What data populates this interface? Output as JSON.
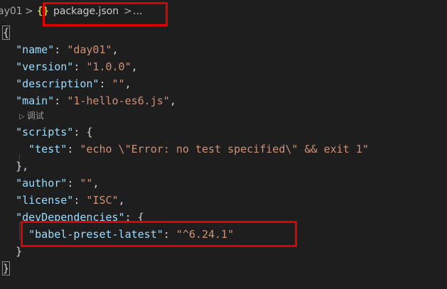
{
  "breadcrumb": {
    "folder": "ay01",
    "separator": ">",
    "json_icon": "{}",
    "file": "package.json",
    "more": "..."
  },
  "codelens": {
    "icon": "▷",
    "label": "调试"
  },
  "code": {
    "open": "{",
    "name_key": "\"name\"",
    "name_val": "\"day01\"",
    "version_key": "\"version\"",
    "version_val": "\"1.0.0\"",
    "description_key": "\"description\"",
    "description_val": "\"\"",
    "main_key": "\"main\"",
    "main_val": "\"1-hello-es6.js\"",
    "scripts_key": "\"scripts\"",
    "test_key": "\"test\"",
    "test_val": "\"echo \\\"Error: no test specified\\\" && exit 1\"",
    "scripts_close": "},",
    "author_key": "\"author\"",
    "author_val": "\"\"",
    "license_key": "\"license\"",
    "license_val": "\"ISC\"",
    "devdeps_key": "\"devDependencies\"",
    "babel_key": "\"babel-preset-latest\"",
    "babel_val": "\"^6.24.1\"",
    "devdeps_close": "}",
    "close": "}"
  },
  "colors": {
    "background": "#1e1e1e",
    "key": "#9cdcfe",
    "string": "#ce9178",
    "punctuation": "#d4d4d4",
    "highlight_box": "#e00000",
    "json_icon": "#cbcb41"
  }
}
